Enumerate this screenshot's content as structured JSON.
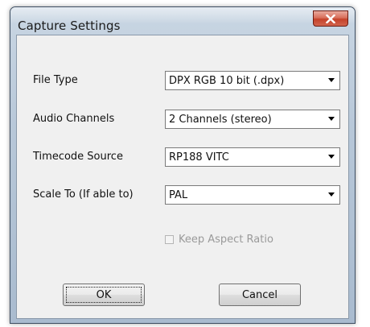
{
  "window": {
    "title": "Capture Settings"
  },
  "icons": {
    "close": "close-icon",
    "dropdown": "chevron-down-icon"
  },
  "form": {
    "file_type": {
      "label": "File Type",
      "value": "DPX RGB 10 bit (.dpx)"
    },
    "audio_channels": {
      "label": "Audio Channels",
      "value": "2 Channels (stereo)"
    },
    "timecode_source": {
      "label": "Timecode Source",
      "value": "RP188 VITC"
    },
    "scale_to": {
      "label": "Scale To (If able to)",
      "value": "PAL"
    },
    "keep_aspect": {
      "label": "Keep Aspect Ratio",
      "checked": false,
      "enabled": false
    }
  },
  "buttons": {
    "ok": "OK",
    "cancel": "Cancel"
  },
  "colors": {
    "close_button": "#c4422a",
    "dialog_face": "#f0f0f0",
    "disabled_text": "#9a9a9a"
  }
}
